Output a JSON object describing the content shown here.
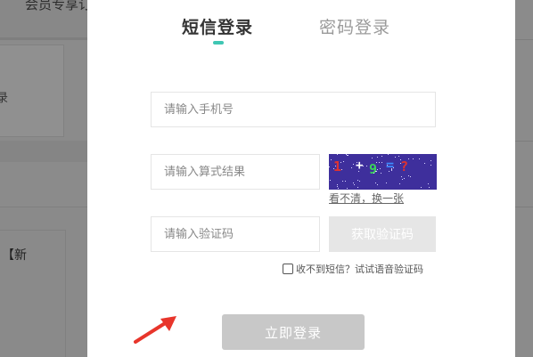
{
  "background": {
    "top_text": "会员专享订",
    "side_text": "录",
    "new_text": "【新"
  },
  "modal": {
    "tabs": [
      {
        "label": "短信登录",
        "active": true
      },
      {
        "label": "密码登录",
        "active": false
      }
    ],
    "accent_color": "#3fc6b3",
    "phone": {
      "placeholder": "请输入手机号",
      "value": ""
    },
    "math": {
      "placeholder": "请输入算式结果",
      "value": ""
    },
    "captcha": {
      "expression": [
        "1",
        "+",
        "9",
        "=",
        "?"
      ],
      "background_color": "#3e2f9c"
    },
    "refresh_link": "看不清，换一张",
    "code": {
      "placeholder": "请输入验证码",
      "value": ""
    },
    "get_code_label": "获取验证码",
    "voice": {
      "checked": false,
      "label": "收不到短信？试试语音验证码"
    },
    "login_label": "立即登录",
    "annotation": {
      "icon": "red-arrow-icon",
      "color": "#e8352b"
    }
  }
}
